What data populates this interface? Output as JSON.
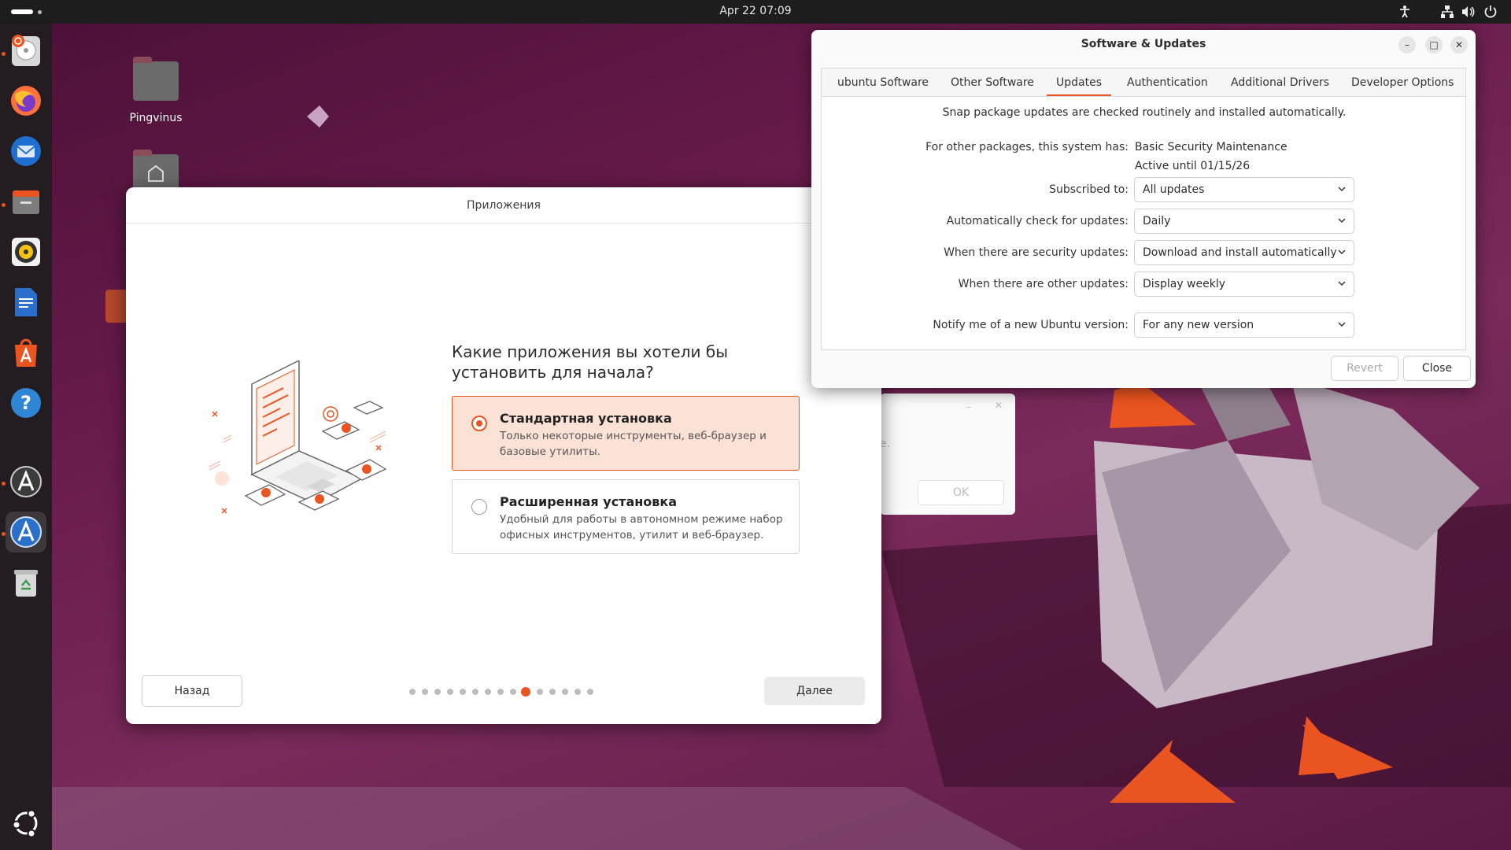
{
  "topbar": {
    "clock": "Apr 22  07:09",
    "tray_icons": [
      "accessibility-icon",
      "network-icon",
      "volume-icon",
      "power-icon"
    ]
  },
  "dock": {
    "items": [
      "ubuntu-installer",
      "firefox",
      "thunderbird",
      "files",
      "rhythmbox",
      "libreoffice-writer",
      "app-center",
      "help",
      "software-updater",
      "software-properties",
      "trash"
    ],
    "show_apps": "show-apps-icon"
  },
  "desktop": {
    "icons": [
      {
        "label": "Pingvinus",
        "icon": "folder-icon"
      },
      {
        "label": "",
        "icon": "home-folder-icon"
      }
    ]
  },
  "installer": {
    "title": "Приложения",
    "question": "Какие приложения вы хотели бы установить для начала?",
    "options": [
      {
        "title": "Стандартная установка",
        "desc": "Только некоторые инструменты, веб-браузер и базовые утилиты.",
        "selected": true
      },
      {
        "title": "Расширенная установка",
        "desc": "Удобный для работы в автономном режиме набор офисных инструментов, утилит и веб-браузер.",
        "selected": false
      }
    ],
    "back_label": "Назад",
    "next_label": "Далее",
    "pages_total": 15,
    "current_page": 10
  },
  "bg_dialog": {
    "ok_label": "OK",
    "partial_text": "e."
  },
  "software_updates": {
    "title": "Software & Updates",
    "tabs": [
      "ubuntu Software",
      "Other Software",
      "Updates",
      "Authentication",
      "Additional Drivers",
      "Developer Options"
    ],
    "active_tab": "Updates",
    "snap_note": "Snap package updates are checked routinely and installed automatically.",
    "other_packages_label": "For other packages, this system has:",
    "maintenance": "Basic Security Maintenance",
    "active_until": "Active until 01/15/26",
    "subscribed_label": "Subscribed to:",
    "subscribed_value": "All updates",
    "auto_check_label": "Automatically check for updates:",
    "auto_check_value": "Daily",
    "security_label": "When there are security updates:",
    "security_value": "Download and install automatically",
    "other_label": "When there are other updates:",
    "other_value": "Display weekly",
    "notify_label": "Notify me of a new Ubuntu version:",
    "notify_value": "For any new version",
    "revert_label": "Revert",
    "close_label": "Close"
  },
  "colors": {
    "accent": "#e95420",
    "topbar": "#1d1d1d",
    "dock": "#231d21"
  }
}
